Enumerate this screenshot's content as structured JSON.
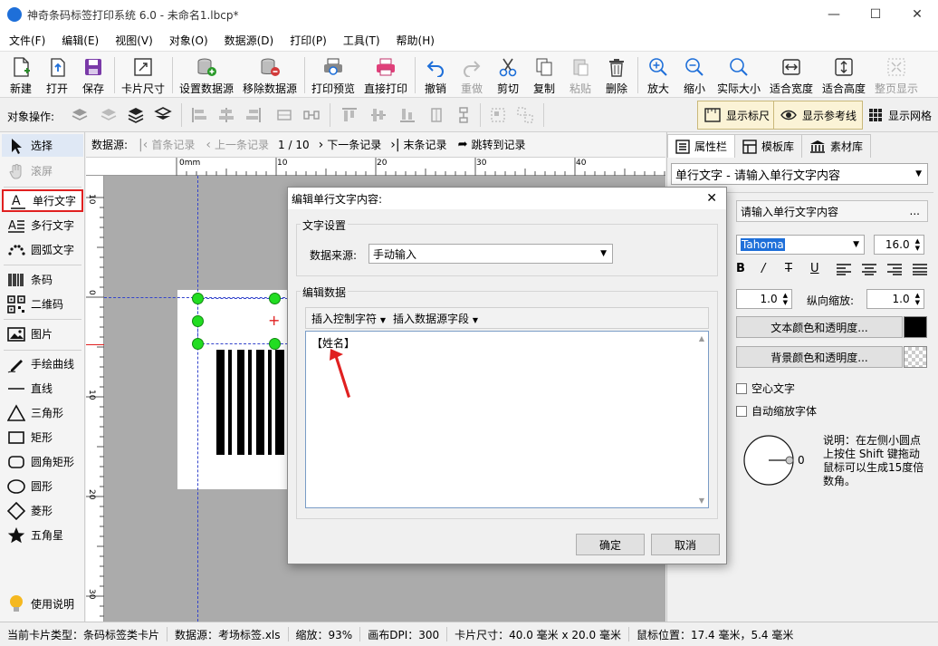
{
  "window": {
    "title": "神奇条码标签打印系统 6.0 - 未命名1.lbcp*",
    "minimize": "—",
    "maximize": "☐",
    "close": "✕"
  },
  "menu": [
    "文件(F)",
    "编辑(E)",
    "视图(V)",
    "对象(O)",
    "数据源(D)",
    "打印(P)",
    "工具(T)",
    "帮助(H)"
  ],
  "toolbar": {
    "new": "新建",
    "open": "打开",
    "save": "保存",
    "card_size": "卡片尺寸",
    "set_ds": "设置数据源",
    "remove_ds": "移除数据源",
    "preview": "打印预览",
    "print": "直接打印",
    "undo": "撤销",
    "redo": "重做",
    "cut": "剪切",
    "copy": "复制",
    "paste": "粘贴",
    "delete": "删除",
    "zoom_in": "放大",
    "zoom_out": "缩小",
    "actual": "实际大小",
    "fit_width": "适合宽度",
    "fit_height": "适合高度",
    "fit_page": "整页显示"
  },
  "objbar": {
    "label": "对象操作:",
    "show_ruler": "显示标尺",
    "show_guides": "显示参考线",
    "show_grid": "显示网格"
  },
  "palette": {
    "select": "选择",
    "pan": "滚屏",
    "single_text": "单行文字",
    "multi_text": "多行文字",
    "arc_text": "圆弧文字",
    "barcode": "条码",
    "qrcode": "二维码",
    "image": "图片",
    "freehand": "手绘曲线",
    "line": "直线",
    "triangle": "三角形",
    "rect": "矩形",
    "round_rect": "圆角矩形",
    "circle": "圆形",
    "diamond": "菱形",
    "star": "五角星",
    "help": "使用说明"
  },
  "nav": {
    "label": "数据源:",
    "first": "首条记录",
    "prev": "上一条记录",
    "pos": "1 / 10",
    "next": "下一条记录",
    "last": "末条记录",
    "jump": "跳转到记录"
  },
  "ruler": {
    "h": [
      "0mm",
      "10",
      "20",
      "30",
      "40"
    ],
    "v": [
      "10",
      "0",
      "10",
      "20",
      "30"
    ]
  },
  "rpanel": {
    "tabs": [
      "属性栏",
      "模板库",
      "素材库"
    ],
    "object_select": "单行文字 - 请输入单行文字内容",
    "content": "请输入单行文字内容",
    "content_more": "...",
    "font": "Tahoma",
    "font_size": "16.0",
    "hscale": "1.0",
    "vscale_label": "纵向缩放:",
    "vscale": "1.0",
    "text_color_btn": "文本颜色和透明度...",
    "bg_color_btn": "背景颜色和透明度...",
    "hollow": "空心文字",
    "auto_shrink": "自动缩放字体",
    "angle": "0",
    "hint": [
      "说明：在左侧小圆点",
      "上按住 Shift 键拖动",
      "鼠标可以生成15度倍",
      "数角。"
    ]
  },
  "status": {
    "card_type": "当前卡片类型：条码标签类卡片",
    "datasource": "数据源：考场标签.xls",
    "zoom": "缩放：93%",
    "dpi": "画布DPI：300",
    "card_size": "卡片尺寸：40.0 毫米 x 20.0 毫米",
    "mouse": "鼠标位置：17.4 毫米，5.4 毫米"
  },
  "dialog": {
    "title": "编辑单行文字内容:",
    "text_settings": "文字设置",
    "source_label": "数据来源:",
    "source_value": "手动输入",
    "edit_data": "编辑数据",
    "insert_ctrl": "插入控制字符",
    "insert_field": "插入数据源字段",
    "content": "【姓名】",
    "ok": "确定",
    "cancel": "取消"
  },
  "colors": {
    "accent": "#1e6fd9",
    "highlight": "#e02020",
    "handle": "#22dd22",
    "guide": "#3344cc",
    "text_color": "#000000"
  }
}
